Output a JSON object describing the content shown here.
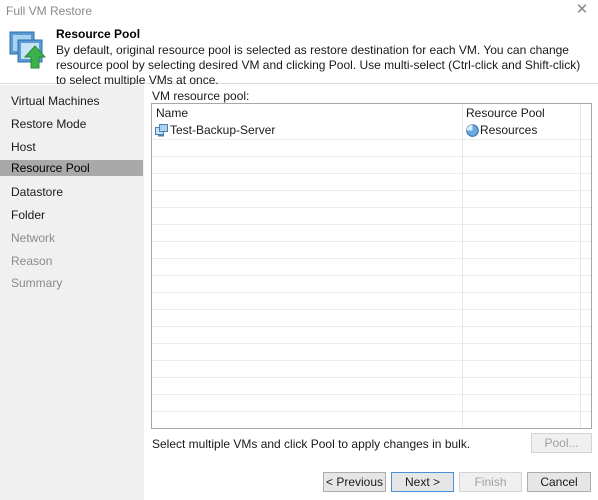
{
  "window": {
    "title": "Full VM Restore",
    "close_glyph": "✕"
  },
  "header": {
    "title": "Resource Pool",
    "description": "By default, original resource pool is selected as restore destination for each VM. You can change resource pool by selecting desired VM and clicking Pool. Use multi-select (Ctrl-click and Shift-click) to select multiple VMs at once.",
    "icon": "vm-restore-arrow-icon"
  },
  "sidebar": {
    "items": [
      {
        "label": "Virtual Machines",
        "state": "enabled"
      },
      {
        "label": "Restore Mode",
        "state": "enabled"
      },
      {
        "label": "Host",
        "state": "enabled"
      },
      {
        "label": "Resource Pool",
        "state": "active"
      },
      {
        "label": "Datastore",
        "state": "enabled"
      },
      {
        "label": "Folder",
        "state": "enabled"
      },
      {
        "label": "Network",
        "state": "disabled"
      },
      {
        "label": "Reason",
        "state": "disabled"
      },
      {
        "label": "Summary",
        "state": "disabled"
      }
    ]
  },
  "main": {
    "grid_label": "VM resource pool:",
    "columns": [
      "Name",
      "Resource Pool"
    ],
    "rows": [
      {
        "name": "Test-Backup-Server",
        "pool": "Resources"
      }
    ],
    "hint": "Select multiple VMs and click Pool to apply changes in bulk.",
    "pool_button": "Pool..."
  },
  "footer": {
    "previous": "< Previous",
    "next": "Next >",
    "finish": "Finish",
    "cancel": "Cancel"
  },
  "colors": {
    "active_nav": "#a9a9a9",
    "sidebar_bg": "#f0f0f0",
    "accent": "#4a90d9"
  }
}
